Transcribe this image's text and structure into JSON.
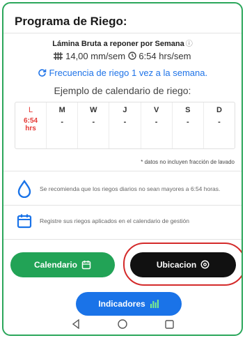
{
  "header": {
    "title": "Programa de Riego:"
  },
  "summary": {
    "lamina_label": "Lámina Bruta a reponer por Semana",
    "lamina_info_icon": "info-icon",
    "rate": "14,00 mm/sem",
    "hours": "6:54 hrs/sem",
    "frequency": "Frecuencia de riego 1 vez a la semana.",
    "example_title": "Ejemplo de calendario de riego:"
  },
  "calendar": {
    "days": [
      {
        "day": "L",
        "value": "6:54 hrs",
        "active": true
      },
      {
        "day": "M",
        "value": "-"
      },
      {
        "day": "W",
        "value": "-"
      },
      {
        "day": "J",
        "value": "-"
      },
      {
        "day": "V",
        "value": "-"
      },
      {
        "day": "S",
        "value": "-"
      },
      {
        "day": "D",
        "value": "-"
      }
    ]
  },
  "note": "* datos no incluyen fracción de lavado",
  "tips": [
    {
      "icon": "water-drop-icon",
      "text": "Se recomienda que los riegos diarios no sean mayores a 6:54 horas."
    },
    {
      "icon": "calendar-icon",
      "text": "Registre sus riegos aplicados en el calendario de gestión"
    }
  ],
  "buttons": {
    "calendario": "Calendario",
    "ubicacion": "Ubicacion",
    "indicadores": "Indicadores"
  },
  "colors": {
    "accent_green": "#22a356",
    "accent_blue": "#1a73e8",
    "highlight_red": "#d42a2a",
    "active_day_red": "#e53935"
  },
  "nav": [
    "back-icon",
    "home-icon",
    "recents-icon"
  ]
}
